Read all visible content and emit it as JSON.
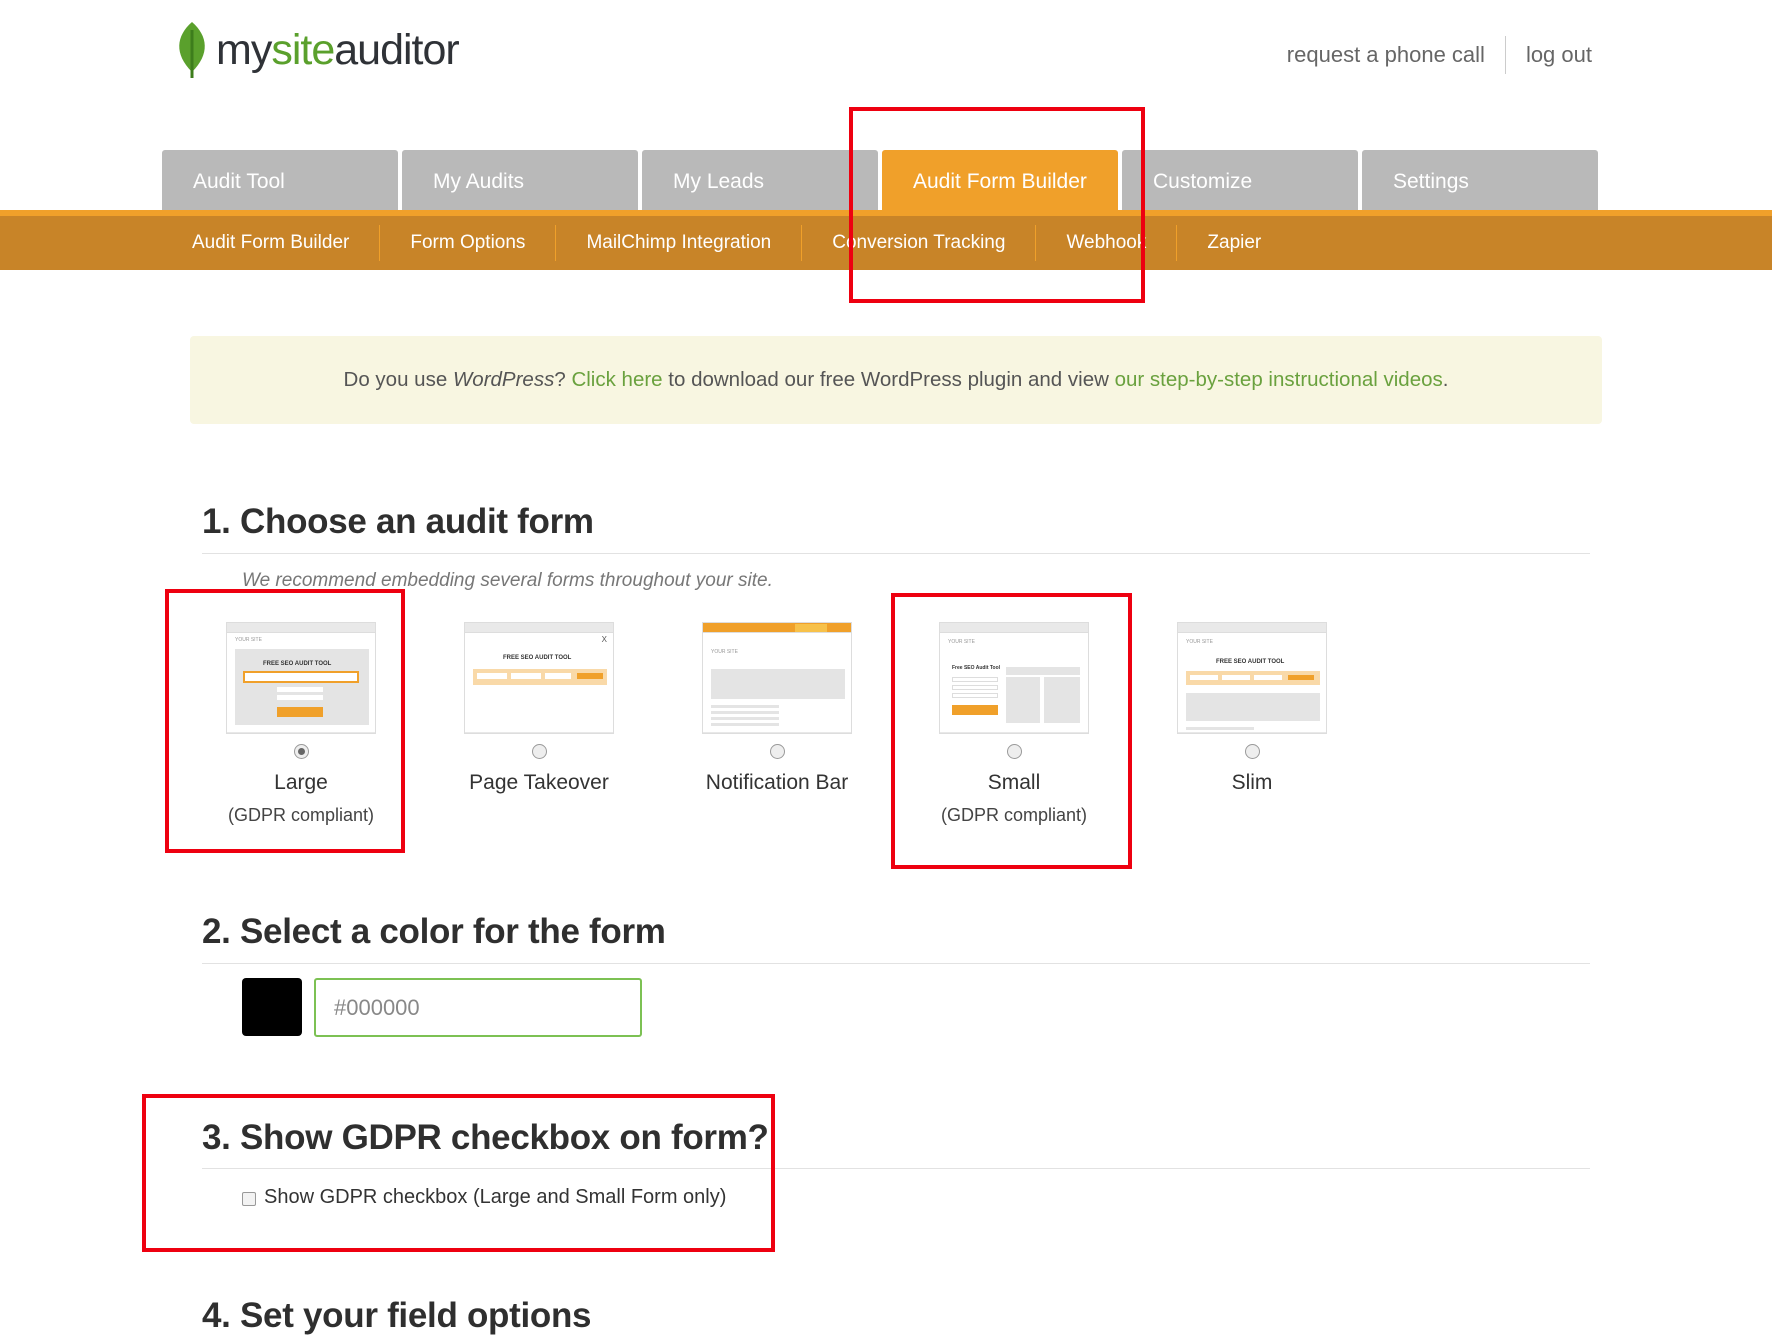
{
  "header": {
    "logo_prefix": "my",
    "logo_highlight": "site",
    "logo_suffix": "auditor",
    "links": [
      "request a phone call",
      "log out"
    ]
  },
  "tabs": [
    {
      "label": "Audit Tool",
      "active": false
    },
    {
      "label": "My Audits",
      "active": false
    },
    {
      "label": "My Leads",
      "active": false
    },
    {
      "label": "Audit Form Builder",
      "active": true
    },
    {
      "label": "Customize",
      "active": false
    },
    {
      "label": "Settings",
      "active": false
    }
  ],
  "subnav": [
    "Audit Form Builder",
    "Form Options",
    "MailChimp Integration",
    "Conversion Tracking",
    "Webhook",
    "Zapier"
  ],
  "notice": {
    "t1": "Do you use ",
    "t2": "WordPress",
    "t3": "? ",
    "link1": "Click here",
    "t4": " to download our free WordPress plugin and view ",
    "link2": "our step-by-step instructional videos",
    "t5": "."
  },
  "section1": {
    "title": "1. Choose an audit form",
    "subtitle": "We recommend embedding several forms throughout your site.",
    "forms": [
      {
        "label": "Large",
        "sub": "(GDPR compliant)",
        "selected": true
      },
      {
        "label": "Page Takeover",
        "sub": "",
        "selected": false
      },
      {
        "label": "Notification Bar",
        "sub": "",
        "selected": false
      },
      {
        "label": "Small",
        "sub": "(GDPR compliant)",
        "selected": false
      },
      {
        "label": "Slim",
        "sub": "",
        "selected": false
      }
    ]
  },
  "section2": {
    "title": "2. Select a color for the form",
    "color_value": "#000000"
  },
  "section3": {
    "title": "3. Show GDPR checkbox on form?",
    "checkbox_label": "Show GDPR checkbox (Large and Small Form only)"
  },
  "section4": {
    "title": "4. Set your field options"
  },
  "colors": {
    "accent_orange": "#f0a02a",
    "subnav_brown": "#c88428",
    "link_green": "#6aa13e",
    "annotation_red": "#ee0010"
  }
}
